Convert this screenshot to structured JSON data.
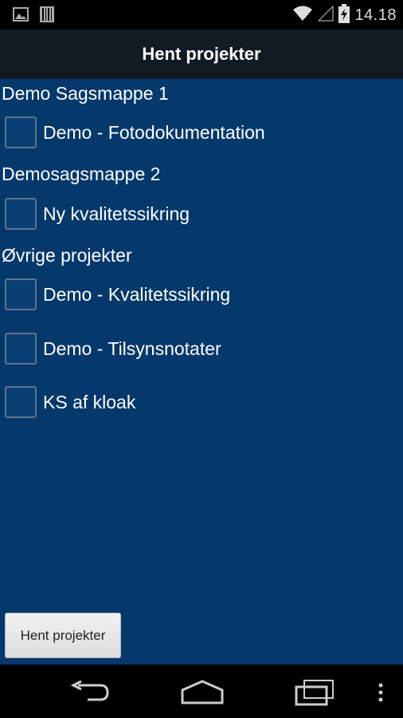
{
  "status_bar": {
    "time": "14.18",
    "left_icons": [
      "image-icon",
      "barcode-icon"
    ],
    "right_icons": [
      "wifi-icon",
      "signal-icon",
      "battery-charging-icon"
    ]
  },
  "header": {
    "title": "Hent projekter"
  },
  "groups": [
    {
      "name": "Demo Sagsmappe 1",
      "projects": [
        {
          "label": "Demo - Fotodokumentation",
          "checked": false
        }
      ]
    },
    {
      "name": "Demosagsmappe 2",
      "projects": [
        {
          "label": "Ny kvalitetssikring",
          "checked": false
        }
      ]
    },
    {
      "name": "Øvrige projekter",
      "projects": [
        {
          "label": "Demo - Kvalitetssikring",
          "checked": false
        },
        {
          "label": "Demo - Tilsynsnotater",
          "checked": false
        },
        {
          "label": "KS af kloak",
          "checked": false
        }
      ]
    }
  ],
  "footer": {
    "button_label": "Hent projekter"
  },
  "nav": {
    "icons": [
      "back-icon",
      "home-icon",
      "recents-icon",
      "menu-icon"
    ]
  },
  "colors": {
    "content_bg": "#05386b",
    "title_bg": "#121a24"
  }
}
